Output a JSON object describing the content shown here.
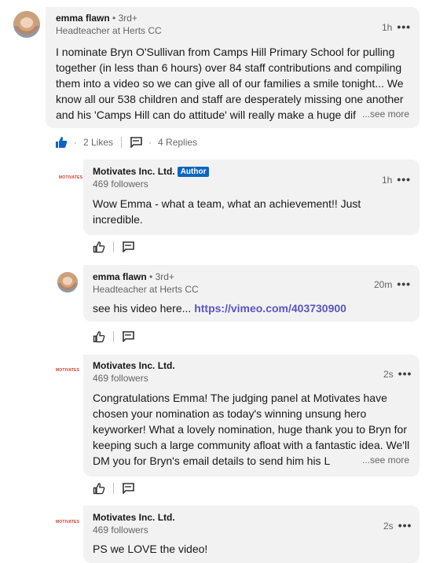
{
  "comments": [
    {
      "author": "emma flawn",
      "degree": "• 3rd+",
      "headline": "Headteacher at Herts CC",
      "time": "1h",
      "text": "I nominate Bryn O'Sullivan from Camps Hill Primary School for pulling together (in less than 6 hours) over 84 staff contributions and compiling them into a video so we can give all of our families a smile tonight... We know all our 538 children and staff are desperately missing one another and his 'Camps Hill can do attitude' will really make a huge dif",
      "see_more": "...see more",
      "likes": "2 Likes",
      "replies": "4 Replies"
    }
  ],
  "replies": [
    {
      "author": "Motivates Inc. Ltd.",
      "badge": "Author",
      "followers": "469 followers",
      "time": "1h",
      "text": "Wow Emma - what a team, what an achievement!! Just incredible."
    },
    {
      "author": "emma flawn",
      "degree": "• 3rd+",
      "headline": "Headteacher at Herts CC",
      "time": "20m",
      "text_prefix": "see his video here...",
      "link": "https://vimeo.com/403730900"
    },
    {
      "author": "Motivates Inc. Ltd.",
      "followers": "469 followers",
      "time": "2s",
      "text": "Congratulations Emma! The judging panel at Motivates have chosen your nomination as today's winning unsung hero keyworker! What a lovely nomination, huge thank you to Bryn for keeping such a large community afloat with a fantastic idea. We'll DM you for Bryn's email details to send him his L",
      "see_more": "...see more"
    },
    {
      "author": "Motivates Inc. Ltd.",
      "followers": "469 followers",
      "time": "2s",
      "text": "PS we LOVE the video!"
    }
  ],
  "logo_text": "MOTIVATES",
  "more_glyph": "•••",
  "colors": {
    "bubble": "#f2f2f2",
    "like_blue": "#0a66c2",
    "link": "#5a55c4",
    "logo_red": "#d33a2c"
  },
  "icons": {
    "like_filled": "like-icon",
    "like_outline": "like-outline-icon",
    "reply": "reply-icon",
    "more": "more-icon"
  }
}
